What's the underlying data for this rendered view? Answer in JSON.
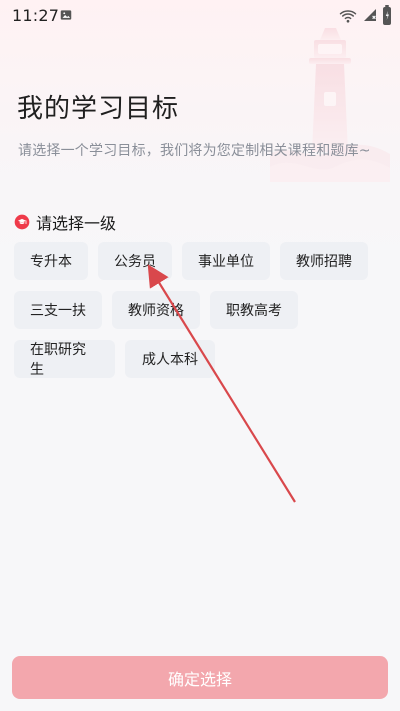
{
  "status_bar": {
    "time": "11:27"
  },
  "header": {
    "title": "我的学习目标",
    "subtitle": "请选择一个学习目标，我们将为您定制相关课程和题库~"
  },
  "section": {
    "title": "请选择一级",
    "icon": "graduation-cap-icon",
    "icon_color": "#ef3a4a"
  },
  "chips": {
    "rows": [
      [
        "专升本",
        "公务员",
        "事业单位",
        "教师招聘"
      ],
      [
        "三支一扶",
        "教师资格",
        "职教高考"
      ],
      [
        "在职研究生",
        "成人本科"
      ]
    ]
  },
  "cta": {
    "label": "确定选择",
    "color": "#f3a7ad"
  },
  "colors": {
    "chip_bg": "#eef0f4",
    "accent": "#ef3a4a",
    "annotation": "#d9484c"
  }
}
